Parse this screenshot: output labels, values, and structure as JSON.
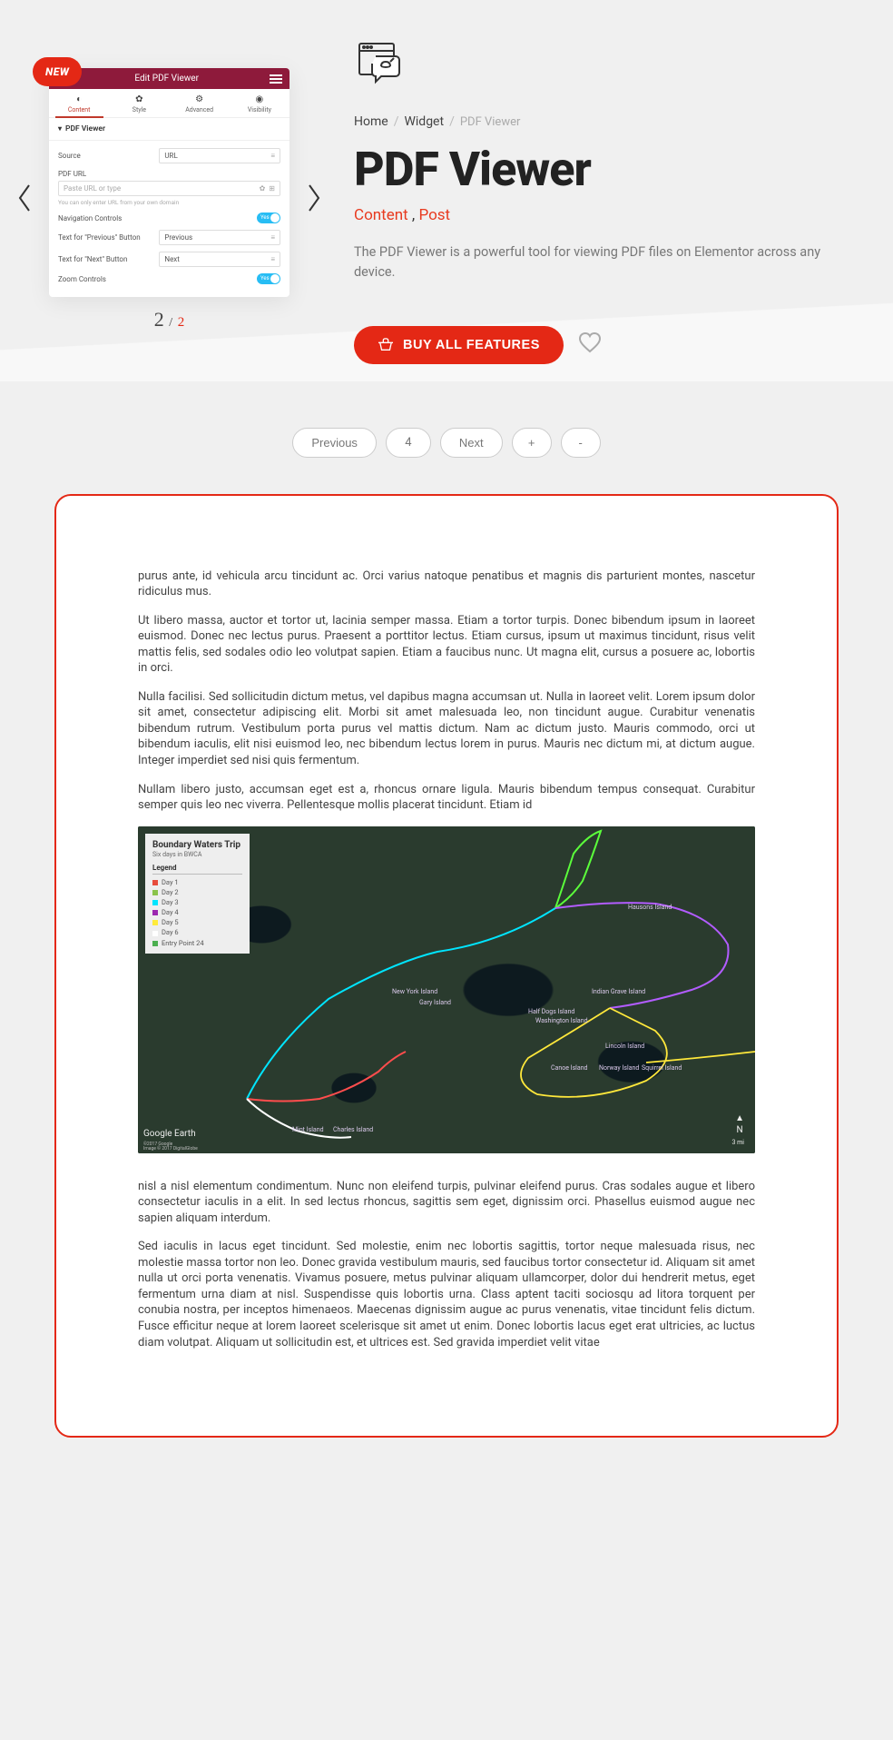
{
  "carousel": {
    "badge": "NEW",
    "panel_title": "Edit PDF Viewer",
    "tabs": [
      {
        "icon": "◐",
        "label": "Content"
      },
      {
        "icon": "✿",
        "label": "Style"
      },
      {
        "icon": "⚙",
        "label": "Advanced"
      },
      {
        "icon": "◉",
        "label": "Visibility"
      }
    ],
    "section": "PDF Viewer",
    "source_label": "Source",
    "source_value": "URL",
    "pdfurl_label": "PDF URL",
    "pdfurl_placeholder": "Paste URL or type",
    "pdfurl_hint": "You can only enter URL from your own domain",
    "nav_label": "Navigation Controls",
    "prev_label": "Text for \"Previous\" Button",
    "prev_value": "Previous",
    "next_label": "Text for \"Next\" Button",
    "next_value": "Next",
    "zoom_label": "Zoom Controls",
    "toggle_text": "Yes",
    "counter_current": "2",
    "counter_total": "2"
  },
  "breadcrumb": {
    "home": "Home",
    "widget": "Widget",
    "current": "PDF Viewer"
  },
  "title": "PDF Viewer",
  "categories": {
    "c1": "Content",
    "sep": " , ",
    "c2": "Post"
  },
  "description": "The PDF Viewer is a powerful tool for viewing PDF files on Elementor across any device.",
  "buy_label": "BUY ALL FEATURES",
  "viewer_controls": {
    "prev": "Previous",
    "page": "4",
    "next": "Next",
    "plus": "+",
    "minus": "-"
  },
  "pdf": {
    "p1": "purus ante, id vehicula arcu tincidunt ac. Orci varius natoque penatibus et magnis dis parturient montes, nascetur ridiculus mus.",
    "p2": "Ut libero massa, auctor et tortor ut, lacinia semper massa. Etiam a tortor turpis. Donec bibendum ipsum in laoreet euismod. Donec nec lectus purus. Praesent a porttitor lectus. Etiam cursus, ipsum ut maximus tincidunt, risus velit mattis felis, sed sodales odio leo volutpat sapien. Etiam a faucibus nunc. Ut magna elit, cursus a posuere ac, lobortis in orci.",
    "p3": "Nulla facilisi. Sed sollicitudin dictum metus, vel dapibus magna accumsan ut. Nulla in laoreet velit. Lorem ipsum dolor sit amet, consectetur adipiscing elit. Morbi sit amet malesuada leo, non tincidunt augue. Curabitur venenatis bibendum rutrum. Vestibulum porta purus vel mattis dictum. Nam ac dictum justo. Mauris commodo, orci ut bibendum iaculis, elit nisi euismod leo, nec bibendum lectus lorem in purus. Mauris nec dictum mi, at dictum augue. Integer imperdiet sed nisi quis fermentum.",
    "p4": "Nullam libero justo, accumsan eget est a, rhoncus ornare ligula. Mauris bibendum tempus consequat. Curabitur semper quis leo nec viverra. Pellentesque mollis placerat tincidunt. Etiam id",
    "p5": "nisl a nisl elementum condimentum. Nunc non eleifend turpis, pulvinar eleifend purus. Cras sodales augue et libero consectetur iaculis in a elit. In sed lectus rhoncus, sagittis sem eget, dignissim orci. Phasellus euismod augue nec sapien aliquam interdum.",
    "p6": "Sed iaculis in lacus eget tincidunt. Sed molestie, enim nec lobortis sagittis, tortor neque malesuada risus, nec molestie massa tortor non leo. Donec gravida vestibulum mauris, sed faucibus tortor consectetur id. Aliquam sit amet nulla ut orci porta venenatis. Vivamus posuere, metus pulvinar aliquam ullamcorper, dolor dui hendrerit metus, eget fermentum urna diam at nisl. Suspendisse quis lobortis urna. Class aptent taciti sociosqu ad litora torquent per conubia nostra, per inceptos himenaeos. Maecenas dignissim augue ac purus venenatis, vitae tincidunt felis dictum. Fusce efficitur neque at lorem laoreet scelerisque sit amet ut enim. Donec lobortis lacus eget erat ultricies, ac luctus diam volutpat. Aliquam ut sollicitudin est, et ultrices est. Sed gravida imperdiet velit vitae"
  },
  "map": {
    "title": "Boundary Waters Trip",
    "subtitle": "Six days in BWCA",
    "legend_header": "Legend",
    "legend": [
      {
        "label": "Day 1",
        "color": "#e74c3c"
      },
      {
        "label": "Day 2",
        "color": "#8bc34a"
      },
      {
        "label": "Day 3",
        "color": "#00e5ff"
      },
      {
        "label": "Day 4",
        "color": "#9c27b0"
      },
      {
        "label": "Day 5",
        "color": "#ffeb3b"
      },
      {
        "label": "Day 6",
        "color": "#ffffff"
      },
      {
        "label": "Entry Point 24",
        "color": "#4caf50"
      }
    ],
    "labels": {
      "hausons": "Hausons Island",
      "newyork": "New York Island",
      "gary": "Gary Island",
      "indian": "Indian Grave Island",
      "halfdog": "Half Dogs Island",
      "washington": "Washington Island",
      "lincoln": "Lincoln Island",
      "canoe": "Canoe Island",
      "norway": "Norway Island",
      "squirrel": "Squirrel Island",
      "mint": "Mint Island",
      "charles": "Charles Island"
    },
    "brand": "Google Earth",
    "credits": "©2017 Google\nImage © 2017 DigitalGlobe",
    "compass": "N",
    "scale": "3 mi"
  }
}
